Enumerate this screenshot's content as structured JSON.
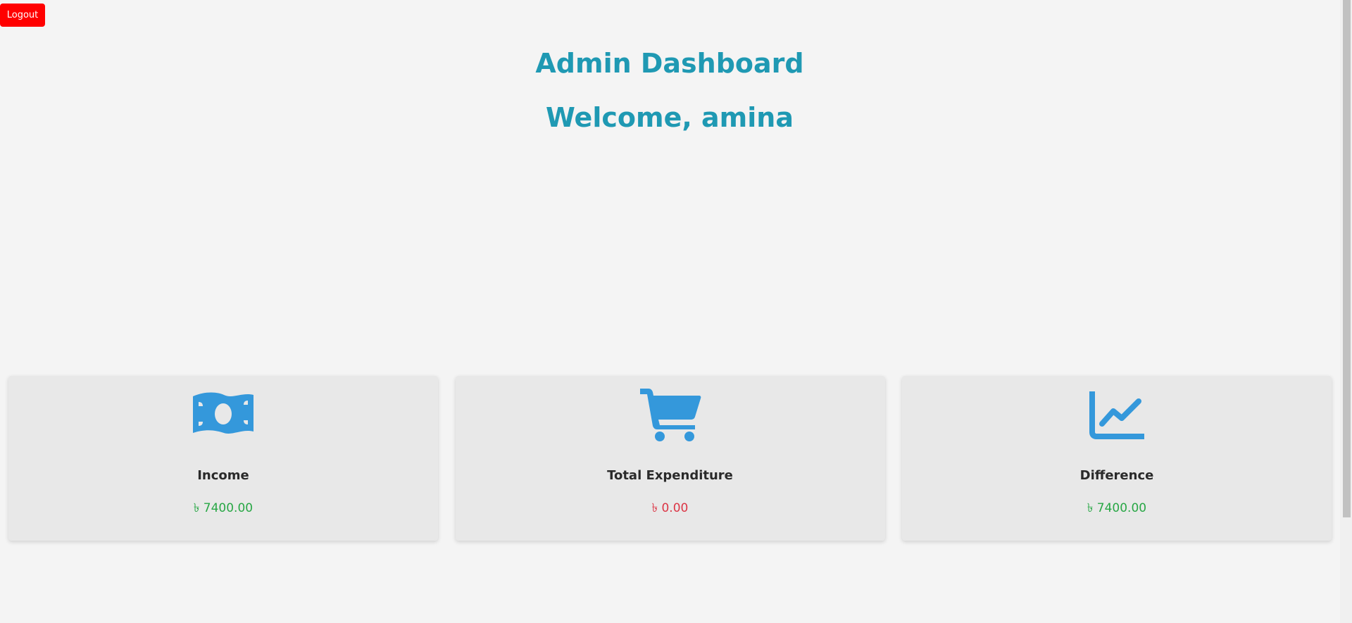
{
  "header": {
    "logout_label": "Logout",
    "title": "Admin Dashboard",
    "welcome": "Welcome, amina",
    "logout_color": "#ff0000",
    "title_color": "#1f99b3"
  },
  "cards": [
    {
      "icon": "money-bill-icon",
      "label": "Income",
      "value": "৳ 7400.00",
      "value_color": "#28a745"
    },
    {
      "icon": "shopping-cart-icon",
      "label": "Total Expenditure",
      "value": "৳ 0.00",
      "value_color": "#dc3545"
    },
    {
      "icon": "chart-line-icon",
      "label": "Difference",
      "value": "৳ 7400.00",
      "value_color": "#28a745"
    }
  ],
  "icon_color": "#3498db"
}
